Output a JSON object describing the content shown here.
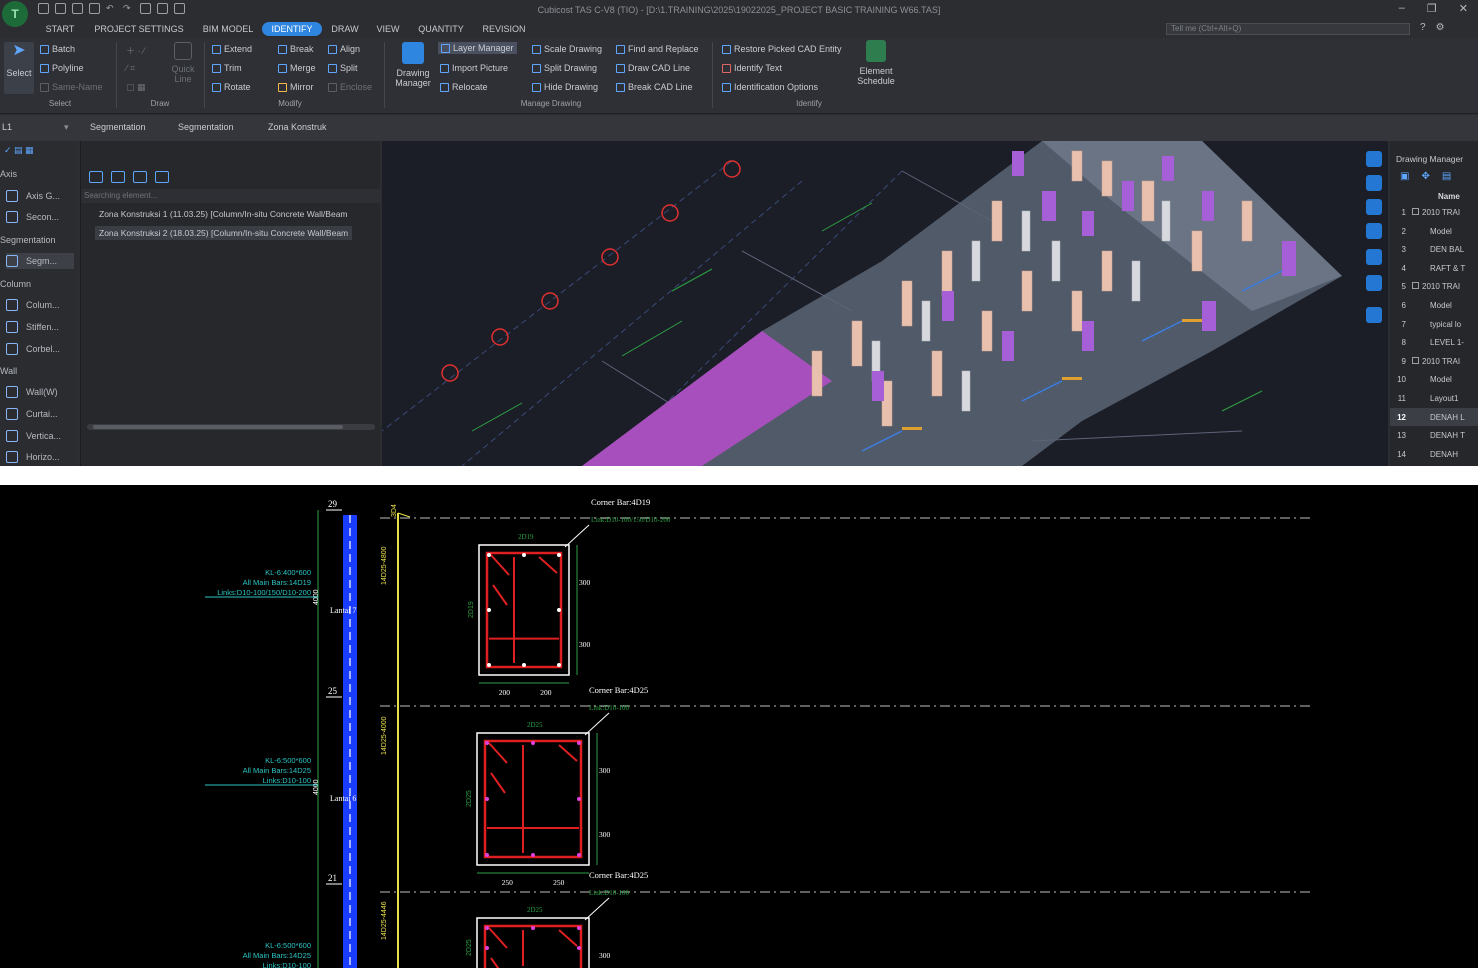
{
  "titlebar": {
    "title": "Cubicost TAS C-V8 (TIO) - [D:\\1.TRAINING\\2025\\19022025_PROJECT BASIC TRAINING W66.TAS]"
  },
  "menu": {
    "tabs": [
      "START",
      "PROJECT SETTINGS",
      "BIM MODEL",
      "IDENTIFY",
      "DRAW",
      "VIEW",
      "QUANTITY",
      "REVISION"
    ],
    "active_tab": "IDENTIFY",
    "search_placeholder": "Tell me (Ctrl+Alt+Q)"
  },
  "ribbon": {
    "select": {
      "big": "Select",
      "batch": "Batch",
      "polyline": "Polyline",
      "same_name": "Same-Name",
      "group": "Select"
    },
    "draw": {
      "quick_line": "Quick Line",
      "group": "Draw"
    },
    "modify": {
      "extend": "Extend",
      "break": "Break",
      "align": "Align",
      "trim": "Trim",
      "merge": "Merge",
      "split": "Split",
      "rotate": "Rotate",
      "mirror": "Mirror",
      "enclose": "Enclose",
      "group": "Modify"
    },
    "manage_drawing": {
      "big": "Drawing Manager",
      "layer_manager": "Layer Manager",
      "import_picture": "Import Picture",
      "relocate": "Relocate",
      "scale_drawing": "Scale Drawing",
      "split_drawing": "Split Drawing",
      "hide_drawing": "Hide Drawing",
      "find_replace": "Find and Replace",
      "draw_cad_line": "Draw CAD Line",
      "break_cad_line": "Break CAD Line",
      "group": "Manage Drawing"
    },
    "identify": {
      "restore": "Restore Picked CAD Entity",
      "identify_text": "Identify Text",
      "options": "Identification Options",
      "element_schedule": "Element Schedule",
      "group": "Identify"
    }
  },
  "subbar": {
    "floor": "L1",
    "dd1": "Segmentation",
    "dd2": "Segmentation",
    "dd3": "Zona Konstruk"
  },
  "leftdock": {
    "sections": [
      {
        "label": "Axis",
        "items": [
          "Axis G...",
          "Secon..."
        ]
      },
      {
        "label": "Segmentation",
        "items": [
          "Segm..."
        ]
      },
      {
        "label": "Column",
        "items": [
          "Colum...",
          "Stiffen...",
          "Corbel..."
        ]
      },
      {
        "label": "Wall",
        "items": [
          "Wall(W)",
          "Curtai...",
          "Vertica...",
          "Horizo..."
        ]
      }
    ]
  },
  "tree": {
    "search_placeholder": "Searching element...",
    "rows": [
      "Zona Konstruksi 1 (11.03.25) [Column/In-situ Concrete Wall/Beam",
      "Zona Konstruksi 2 (18.03.25) [Column/In-situ Concrete Wall/Beam"
    ],
    "selected_row": 1
  },
  "drawing_manager": {
    "title": "Drawing Manager",
    "col": "Name",
    "rows": [
      {
        "n": "1",
        "t": "2010 TRAI",
        "exp": true
      },
      {
        "n": "2",
        "t": "Model"
      },
      {
        "n": "3",
        "t": "DEN BAL"
      },
      {
        "n": "4",
        "t": "RAFT & T"
      },
      {
        "n": "5",
        "t": "2010 TRAI",
        "exp": true
      },
      {
        "n": "6",
        "t": "Model"
      },
      {
        "n": "7",
        "t": "typical lo"
      },
      {
        "n": "8",
        "t": "LEVEL 1-"
      },
      {
        "n": "9",
        "t": "2010 TRAI",
        "exp": true
      },
      {
        "n": "10",
        "t": "Model"
      },
      {
        "n": "11",
        "t": "Layout1"
      },
      {
        "n": "12",
        "t": "DENAH L",
        "sel": true
      },
      {
        "n": "13",
        "t": "DENAH T"
      },
      {
        "n": "14",
        "t": "DENAH"
      }
    ]
  },
  "cad": {
    "level_numbers": [
      "29",
      "25",
      "21"
    ],
    "rebar_ids": [
      "3D4",
      "14D25-4800",
      "14D25-4000",
      "14D25-4446"
    ],
    "lantai": [
      "Lantai 7",
      "Lantai 6"
    ],
    "column_tags": [
      {
        "k": "KL-6:400*600",
        "m": "All Main Bars:14D19",
        "s": "Links:D10-100/150/D10-200"
      },
      {
        "k": "KL-6:500*600",
        "m": "All Main Bars:14D25",
        "s": "Links:D10-100"
      },
      {
        "k": "KL-6:500*600",
        "m": "All Main Bars:14D25",
        "s": "Links:D10-100"
      }
    ],
    "sections": [
      {
        "corner": "Corner Bar:4D19",
        "links": "Link:D10-100/150/D10-200",
        "top": "2D19",
        "side": "2D19",
        "d1": "300",
        "d2": "300",
        "b1": "200",
        "b2": "200"
      },
      {
        "corner": "Corner Bar:4D25",
        "links": "Link:D10-100",
        "top": "2D25",
        "side": "2D25",
        "d1": "300",
        "d2": "300",
        "b1": "250",
        "b2": "250"
      },
      {
        "corner": "Corner Bar:4D25",
        "links": "Link:D10-100",
        "top": "2D25",
        "side": "2D25",
        "d1": "300",
        "d2": "",
        "b1": "",
        "b2": ""
      }
    ],
    "elev_label": "4000"
  }
}
